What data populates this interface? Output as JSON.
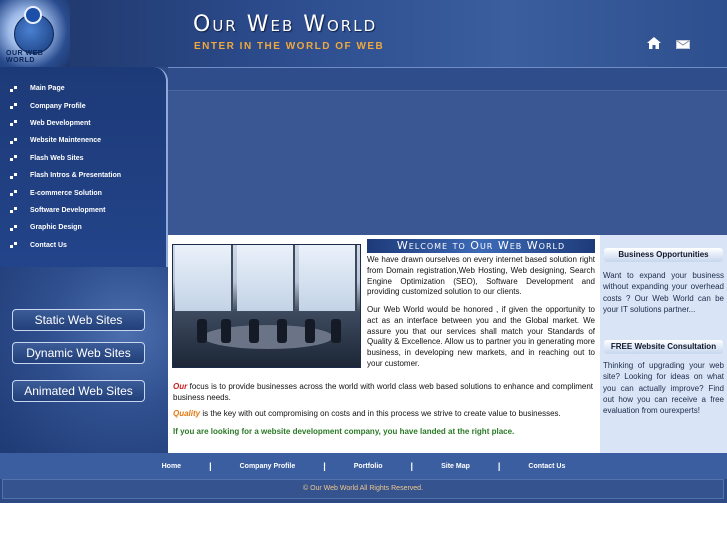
{
  "header": {
    "logo_text": "OUR WEB WORLD",
    "title": "Our Web World",
    "tagline": "ENTER IN THE WORLD OF WEB"
  },
  "leftnav": {
    "items": [
      {
        "label": "Main Page"
      },
      {
        "label": "Company Profile"
      },
      {
        "label": "Web Development"
      },
      {
        "label": "Website Maintenence"
      },
      {
        "label": "Flash Web Sites"
      },
      {
        "label": "Flash Intros & Presentation"
      },
      {
        "label": "E-commerce Solution"
      },
      {
        "label": "Software Development"
      },
      {
        "label": "Graphic Design"
      },
      {
        "label": "Contact Us"
      }
    ]
  },
  "side_buttons": {
    "static": "Static Web Sites",
    "dynamic": "Dynamic Web Sites",
    "animated": "Animated Web Sites"
  },
  "content": {
    "welcome_title": "Welcome to Our Web World",
    "p1": "We have drawn ourselves on every internet based solution right from Domain registration,Web Hosting, Web designing, Search Engine Optimization (SEO), Software Development and providing customized solution to our clients.",
    "p2": "Our Web World would be honored , if given the opportunity to act as an interface between you and the Global market. We assure you that our services shall match your Standards of Quality & Excellence. Allow us to partner you in generating more business, in developing new markets, and in reaching out to your customer.",
    "p3_em": "Our",
    "p3": " focus is to provide businesses across the world with world class web based solutions to enhance and compliment business needs.",
    "p4_em": "Quality",
    "p4": " is the key with out compromising on costs and in this process we strive to create value to businesses.",
    "p5": "If you are looking for a website development company, you have landed at the right place."
  },
  "rightcol": {
    "head1": "Business Opportunities",
    "text1": "Want to expand your business without expanding your overhead costs ? Our Web World can be your IT solutions partner...",
    "head2": "FREE Website Consultation",
    "text2": "Thinking of upgrading your web site? Looking for ideas on what you can actually improve? Find out how you can receive a free evaluation from ourexperts!"
  },
  "footer": {
    "links": [
      {
        "label": "Home"
      },
      {
        "label": "Company Profile"
      },
      {
        "label": "Portfolio"
      },
      {
        "label": "Site Map"
      },
      {
        "label": "Contact Us"
      }
    ],
    "separator": "|",
    "copyright": "© Our Web World All Rights Reserved."
  },
  "icons": {
    "home": "home-icon",
    "mail": "mail-icon",
    "bullet": "bullet-icon"
  },
  "colors": {
    "tagline": "#f0a83c",
    "accent_red": "#cc1e1e",
    "accent_orange": "#e07a12",
    "accent_green": "#2a7a26"
  }
}
